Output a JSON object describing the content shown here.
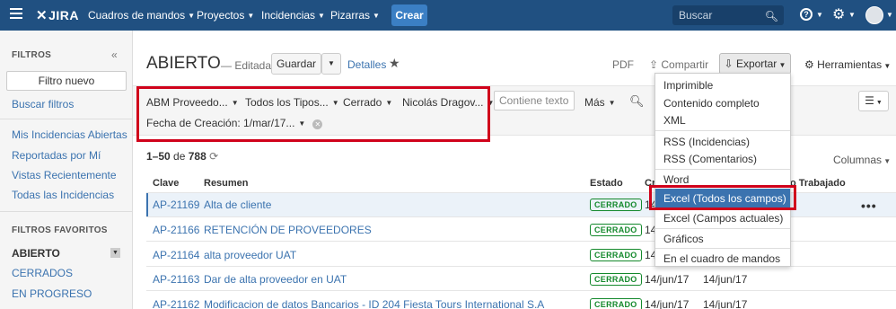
{
  "app": {
    "logo": "JIRA",
    "nav": [
      "Cuadros de mandos",
      "Proyectos",
      "Incidencias",
      "Pizarras"
    ],
    "create_label": "Crear",
    "search_placeholder": "Buscar",
    "accent_color": "#205081"
  },
  "sidebar": {
    "heading": "FILTROS",
    "collapse_icon": "double-chevron-left-icon",
    "new_filter_label": "Filtro nuevo",
    "search_filters": "Buscar filtros",
    "links": [
      "Mis Incidencias Abiertas",
      "Reportadas por Mí",
      "Vistas Recientemente",
      "Todas las Incidencias"
    ],
    "favorites_heading": "FILTROS FAVORITOS",
    "favorites": [
      "ABIERTO",
      "CERRADOS",
      "EN PROGRESO"
    ]
  },
  "header": {
    "title": "ABIERTO",
    "edited": "— Editada",
    "save_label": "Guardar",
    "details_label": "Detalles",
    "pdf": "PDF",
    "share": "Compartir",
    "export": "Exportar",
    "tools": "Herramientas"
  },
  "filters": {
    "chips": [
      "ABM Proveedo...",
      "Todos los Tipos...",
      "Cerrado",
      "Nicolás Dragov..."
    ],
    "date_chip": "Fecha de Creación: 1/mar/17...",
    "text_placeholder": "Contiene texto",
    "more": "Más"
  },
  "results": {
    "range": "1–50",
    "of": "de",
    "total": "788",
    "columns_label": "Columnas",
    "headers": {
      "key": "Clave",
      "summary": "Resumen",
      "status": "Estado",
      "created": "Cr",
      "worked": "o Trabajado"
    },
    "rows": [
      {
        "key": "AP-21169",
        "summary": "Alta de cliente",
        "status": "CERRADO",
        "created": "14",
        "updated": ""
      },
      {
        "key": "AP-21166",
        "summary": "RETENCIÓN DE PROVEEDORES",
        "status": "CERRADO",
        "created": "14",
        "updated": ""
      },
      {
        "key": "AP-21164",
        "summary": "alta proveedor UAT",
        "status": "CERRADO",
        "created": "14",
        "updated": ""
      },
      {
        "key": "AP-21163",
        "summary": "Dar de alta proveedor en UAT",
        "status": "CERRADO",
        "created": "14/jun/17",
        "updated": "14/jun/17"
      },
      {
        "key": "AP-21162",
        "summary": "Modificacion de datos Bancarios - ID 204 Fiesta Tours International S.A",
        "status": "CERRADO",
        "created": "14/jun/17",
        "updated": "14/jun/17"
      }
    ]
  },
  "export_menu": {
    "items": [
      "Imprimible",
      "Contenido completo",
      "XML",
      "RSS (Incidencias)",
      "RSS (Comentarios)",
      "Word",
      "Excel (Todos los campos)",
      "Excel (Campos actuales)",
      "Gráficos",
      "En el cuadro de mandos"
    ],
    "selected": "Excel (Todos los campos)",
    "highlight_color": "#3b73af",
    "annotation_color": "#d0021b"
  }
}
